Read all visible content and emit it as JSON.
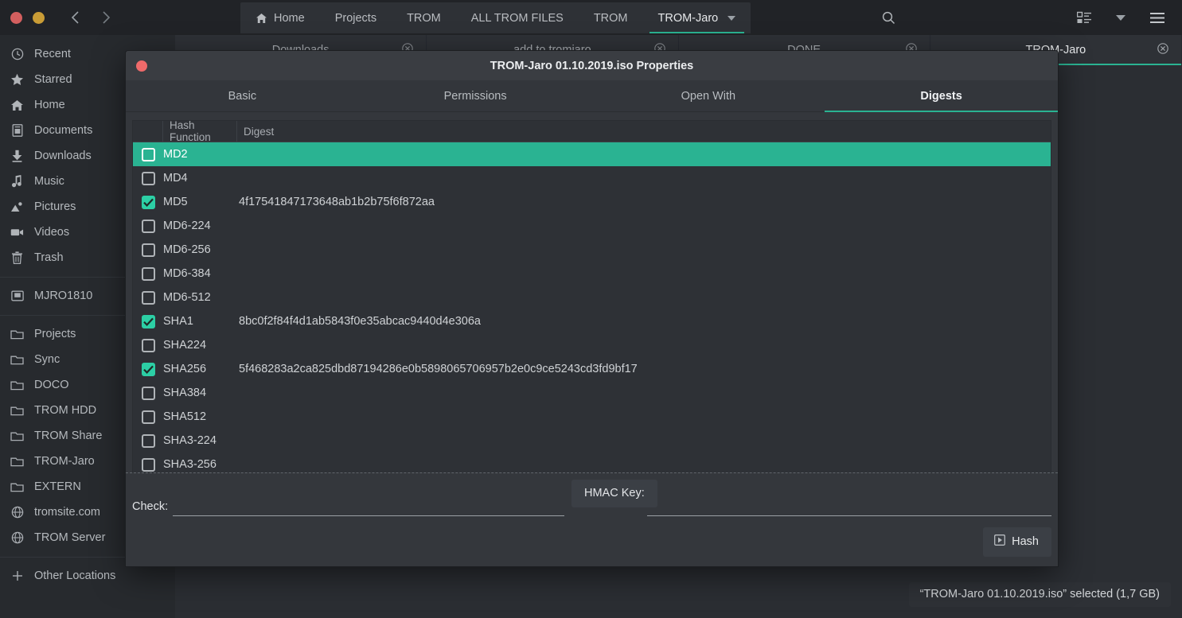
{
  "file_manager": {
    "window_buttons": [
      {
        "name": "close",
        "color": "#d35f5f"
      },
      {
        "name": "minimize",
        "color": "#c99c36"
      }
    ],
    "breadcrumb_tabs": [
      {
        "label": "Home",
        "icon": "home-icon",
        "active": false
      },
      {
        "label": "Projects",
        "icon": "",
        "active": false
      },
      {
        "label": "TROM",
        "icon": "",
        "active": false
      },
      {
        "label": "ALL TROM FILES",
        "icon": "",
        "active": false
      },
      {
        "label": "TROM",
        "icon": "",
        "active": false
      },
      {
        "label": "TROM-Jaro",
        "icon": "chevron-down-icon",
        "active": true
      }
    ],
    "header_icons": [
      "search-icon",
      "view-list-icon",
      "chevron-down-icon",
      "hamburger-menu-icon"
    ],
    "sidebar": {
      "groups": [
        {
          "items": [
            {
              "label": "Recent",
              "icon": "clock-icon"
            },
            {
              "label": "Starred",
              "icon": "star-icon"
            },
            {
              "label": "Home",
              "icon": "home-icon"
            },
            {
              "label": "Documents",
              "icon": "documents-icon"
            },
            {
              "label": "Downloads",
              "icon": "download-icon"
            },
            {
              "label": "Music",
              "icon": "music-note-icon"
            },
            {
              "label": "Pictures",
              "icon": "pictures-icon"
            },
            {
              "label": "Videos",
              "icon": "video-camera-icon"
            },
            {
              "label": "Trash",
              "icon": "trash-icon"
            }
          ]
        },
        {
          "items": [
            {
              "label": "MJRO1810",
              "icon": "drive-icon"
            }
          ]
        },
        {
          "items": [
            {
              "label": "Projects",
              "icon": "folder-icon"
            },
            {
              "label": "Sync",
              "icon": "folder-icon"
            },
            {
              "label": "DOCO",
              "icon": "folder-icon"
            },
            {
              "label": "TROM HDD",
              "icon": "folder-icon"
            },
            {
              "label": "TROM Share",
              "icon": "folder-icon"
            },
            {
              "label": "TROM-Jaro",
              "icon": "folder-icon"
            },
            {
              "label": "EXTERN",
              "icon": "folder-icon"
            },
            {
              "label": "tromsite.com",
              "icon": "globe-icon"
            },
            {
              "label": "TROM Server",
              "icon": "globe-icon"
            }
          ]
        },
        {
          "items": [
            {
              "label": "Other Locations",
              "icon": "plus-icon"
            }
          ]
        }
      ]
    },
    "content_tabs": [
      {
        "label": "Downloads",
        "active": false,
        "close_icon": "close-circle-icon"
      },
      {
        "label": "add to tromjaro",
        "active": false,
        "close_icon": "close-circle-icon"
      },
      {
        "label": "DONE",
        "active": false,
        "close_icon": "close-circle-icon"
      },
      {
        "label": "TROM-Jaro",
        "active": true,
        "close_icon": "close-circle-icon"
      }
    ],
    "status_text": "“TROM-Jaro 01.10.2019.iso” selected  (1,7 GB)"
  },
  "dialog": {
    "title": "TROM-Jaro 01.10.2019.iso Properties",
    "close_icon": "close-circle-icon",
    "tabs": [
      {
        "label": "Basic",
        "active": false
      },
      {
        "label": "Permissions",
        "active": false
      },
      {
        "label": "Open With",
        "active": false
      },
      {
        "label": "Digests",
        "active": true
      }
    ],
    "table": {
      "columns": [
        "",
        "Hash Function",
        "Digest"
      ],
      "rows": [
        {
          "checked": false,
          "fn": "MD2",
          "digest": "",
          "selected": true
        },
        {
          "checked": false,
          "fn": "MD4",
          "digest": "",
          "selected": false
        },
        {
          "checked": true,
          "fn": "MD5",
          "digest": "4f17541847173648ab1b2b75f6f872aa",
          "selected": false
        },
        {
          "checked": false,
          "fn": "MD6-224",
          "digest": "",
          "selected": false
        },
        {
          "checked": false,
          "fn": "MD6-256",
          "digest": "",
          "selected": false
        },
        {
          "checked": false,
          "fn": "MD6-384",
          "digest": "",
          "selected": false
        },
        {
          "checked": false,
          "fn": "MD6-512",
          "digest": "",
          "selected": false
        },
        {
          "checked": true,
          "fn": "SHA1",
          "digest": "8bc0f2f84f4d1ab5843f0e35abcac9440d4e306a",
          "selected": false
        },
        {
          "checked": false,
          "fn": "SHA224",
          "digest": "",
          "selected": false
        },
        {
          "checked": true,
          "fn": "SHA256",
          "digest": "5f468283a2ca825dbd87194286e0b5898065706957b2e0c9ce5243cd3fd9bf17",
          "selected": false
        },
        {
          "checked": false,
          "fn": "SHA384",
          "digest": "",
          "selected": false
        },
        {
          "checked": false,
          "fn": "SHA512",
          "digest": "",
          "selected": false
        },
        {
          "checked": false,
          "fn": "SHA3-224",
          "digest": "",
          "selected": false
        },
        {
          "checked": false,
          "fn": "SHA3-256",
          "digest": "",
          "selected": false
        }
      ]
    },
    "footer": {
      "check_label": "Check:",
      "check_value": "",
      "check_placeholder": "",
      "hmac_label": "HMAC Key:",
      "hash_label": "Hash",
      "hash_icon": "execute-icon"
    }
  },
  "colors": {
    "accent_teal": "#2ab392",
    "checkbox_teal": "#2ccfa5",
    "dialog_bg": "#34373c",
    "table_bg": "#2e3136",
    "window_bg": "#2b2e33",
    "sidebar_bg": "#272a2e",
    "headerbar_bg": "#212327",
    "close_red": "#ef6a6a",
    "min_yellow": "#c99c36"
  }
}
